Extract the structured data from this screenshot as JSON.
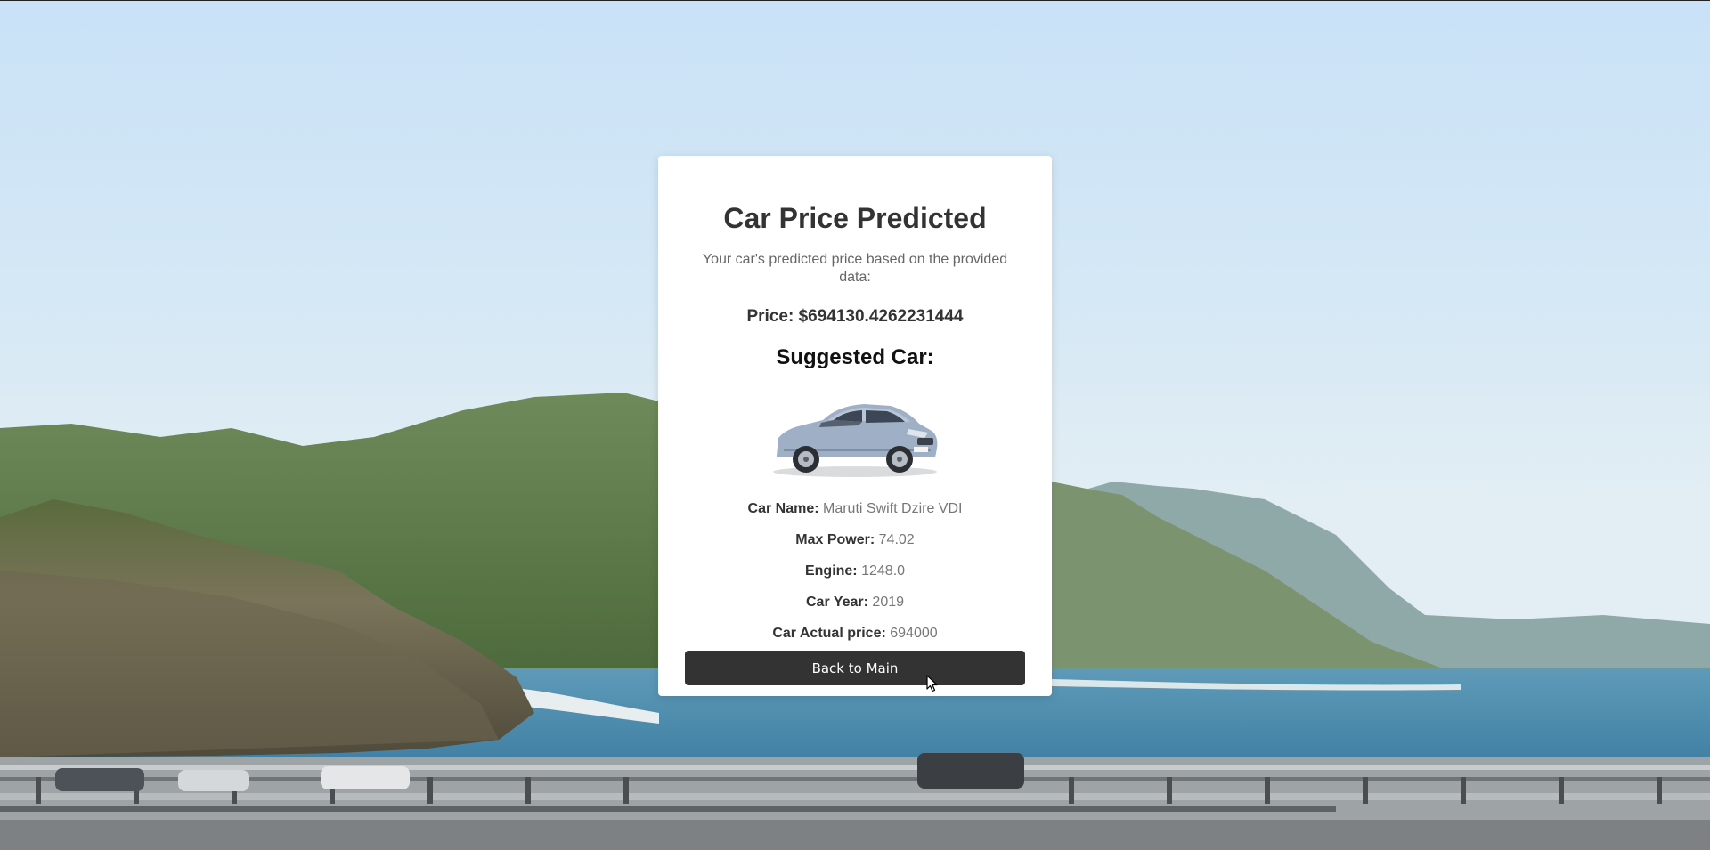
{
  "result": {
    "title": "Car Price Predicted",
    "subtitle": "Your car's predicted price based on the provided data:",
    "price_text": "Price: $694130.4262231444",
    "suggested_heading": "Suggested Car:"
  },
  "car": {
    "image_alt": "Maruti Swift Dzire VDI",
    "details": [
      {
        "label": "Car Name:",
        "value": "Maruti Swift Dzire VDI"
      },
      {
        "label": "Max Power:",
        "value": "74.02"
      },
      {
        "label": "Engine:",
        "value": "1248.0"
      },
      {
        "label": "Car Year:",
        "value": "2019"
      },
      {
        "label": "Car Actual price:",
        "value": "694000"
      }
    ]
  },
  "actions": {
    "back_label": "Back to Main"
  },
  "icons": {
    "cursor": "mouse-pointer-icon"
  },
  "colors": {
    "button_bg": "#333333",
    "card_bg": "#ffffff",
    "title_text": "#333333",
    "value_text": "#777777"
  }
}
